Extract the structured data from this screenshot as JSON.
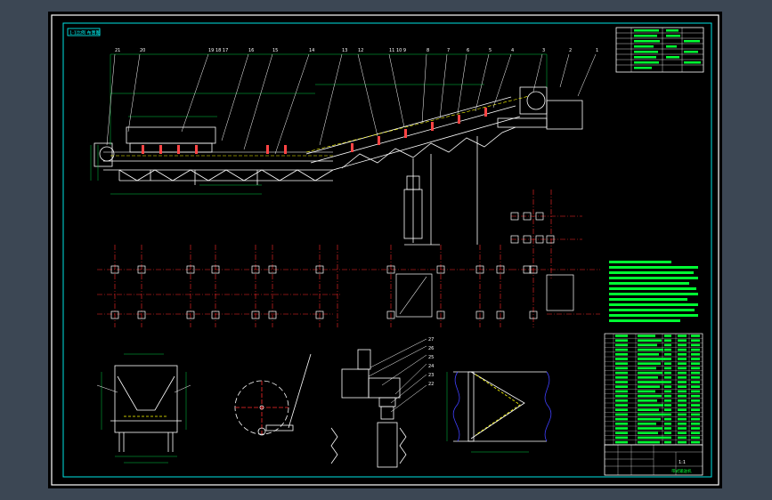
{
  "drawing": {
    "stamp": "1:1比例 布置图",
    "part_numbers_top": [
      "21",
      "20",
      "19 18 17",
      "16",
      "15",
      "14",
      "13",
      "12",
      "11 10 9",
      "8",
      "7",
      "6",
      "5",
      "4",
      "3",
      "2",
      "1"
    ],
    "callouts_right_detail": [
      "27",
      "26",
      "25",
      "24",
      "23",
      "22"
    ],
    "title_block": {
      "scale": "1:1",
      "name": "带式输送机"
    }
  },
  "colors": {
    "paper": "#000000",
    "frame": "#00e5e5",
    "outline": "#ffffff",
    "centerline": "#ff2a2a",
    "annotation": "#00ff33",
    "dimension": "#00cc44"
  }
}
